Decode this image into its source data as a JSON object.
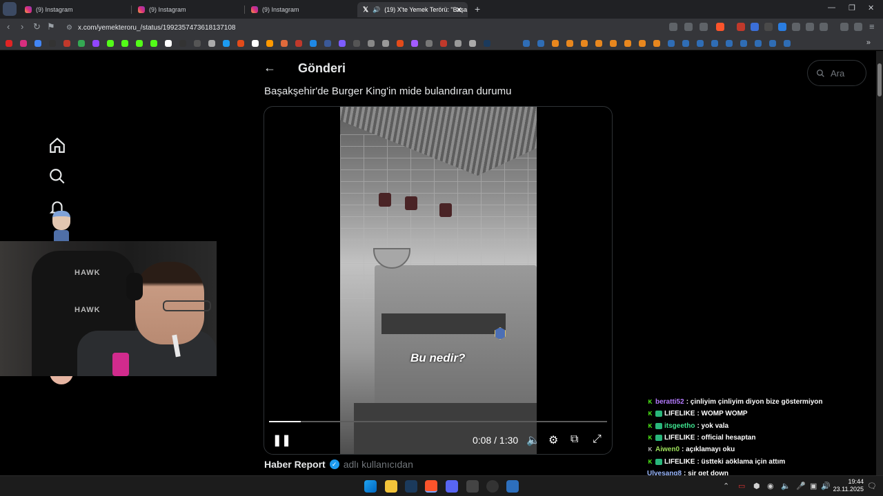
{
  "browser": {
    "tabs": [
      {
        "label": "(9) Instagram"
      },
      {
        "label": "(9) Instagram"
      },
      {
        "label": "(9) Instagram"
      },
      {
        "label": "(19) X'te Yemek Terörü: \"Başa"
      }
    ],
    "url": "x.com/yemekteroru_/status/1992357473618137108"
  },
  "post": {
    "header_title": "Gönderi",
    "search_placeholder": "Ara",
    "text": "Başakşehir'de Burger King'in mide bulandıran durumu",
    "video": {
      "caption": "Bu nedir?",
      "time_display": "0:08 / 1:30",
      "progress_fraction": 0.094
    },
    "author_name": "Haber Report",
    "author_suffix": "adlı kullanıcıdan"
  },
  "webcam": {
    "chair_logo": "HAWK"
  },
  "chat": [
    {
      "user": "beratti52",
      "color": "#b57bff",
      "message": ": çinliyim çinliyim diyon bize göstermiyon",
      "sub": false
    },
    {
      "user": "LIFELIKE",
      "color": "#ffffff",
      "message": ": WOMP WOMP",
      "sub": true
    },
    {
      "user": "itsgeetho",
      "color": "#3ee38f",
      "message": ": yok vala",
      "sub": true
    },
    {
      "user": "LIFELIKE",
      "color": "#ffffff",
      "message": ": official hesaptan",
      "sub": true
    },
    {
      "user": "Aiwen0",
      "color": "#9de05a",
      "message": ": açıklamayı oku",
      "sub": false
    },
    {
      "user": "LIFELIKE",
      "color": "#ffffff",
      "message": ": üstteki aöklama için attım",
      "sub": true
    },
    {
      "user": "Ulvesang8",
      "color": "#9bb8ff",
      "message": ": sir get down",
      "sub": false
    }
  ],
  "taskbar": {
    "time": "19:44",
    "date": "23.11.2025"
  }
}
